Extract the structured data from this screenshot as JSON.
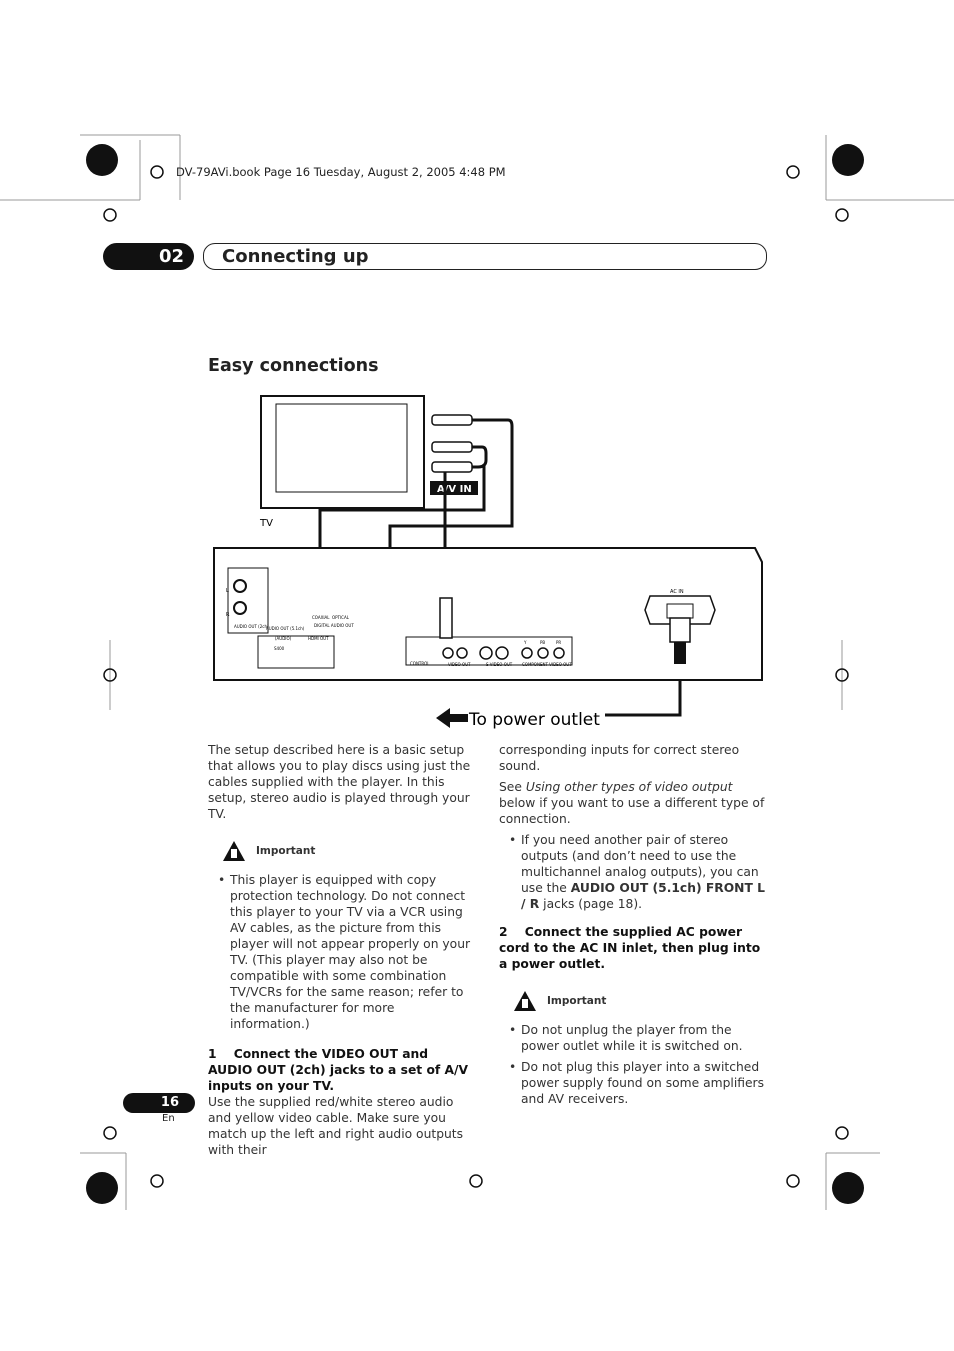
{
  "header": {
    "file_line": "DV-79AVi.book  Page 16  Tuesday, August 2, 2005  4:48 PM",
    "chapter_number": "02",
    "chapter_title": "Connecting up"
  },
  "section_title": "Easy connections",
  "diagram": {
    "tv_label": "TV",
    "av_in": "A/V IN",
    "power_outlet": "To power outlet",
    "ac_in": "AC  IN",
    "labels": {
      "l": "L",
      "r": "R",
      "audio_out_2ch": "AUDIO OUT (2ch)",
      "audio_out_51": "AUDIO OUT (5.1ch)",
      "coaxial": "COAXIAL",
      "optical": "OPTICAL",
      "digital_audio_out": "DIGITAL AUDIO OUT",
      "i_link": "(AUDIO)",
      "s400": "S400",
      "hdmi_out": "HDMI OUT",
      "control": "CONTROL",
      "video_out": "VIDEO OUT",
      "s_video_out": "S-VIDEO OUT",
      "component": "COMPONENT VIDEO OUT",
      "y": "Y",
      "pb": "PB",
      "pr": "PR"
    }
  },
  "left_column": {
    "intro": "The setup described here is a basic setup that allows you to play discs using just the cables supplied with the player. In this setup, stereo audio is played through your TV.",
    "important_label": "Important",
    "important_items": [
      "This player is equipped with copy protection technology. Do not connect this player to your TV via a VCR using AV cables, as the picture from this player will not appear properly on your TV. (This player may also not be compatible with some combination TV/VCRs for the same reason; refer to the manufacturer for more information.)"
    ],
    "step1_num": "1",
    "step1_title": "Connect the VIDEO OUT and AUDIO OUT (2ch) jacks to a set of A/V inputs on your TV.",
    "step1_body": "Use the supplied red/white stereo audio and yellow video cable. Make sure you match up the left and right audio outputs with their"
  },
  "right_column": {
    "cont": "corresponding inputs for correct stereo sound.",
    "see_pre": "See ",
    "see_italic": "Using other types of video output",
    "see_post": " below if you want to use a different type of connection.",
    "bullet_pre": "If you need another pair of stereo outputs (and don’t need to use the multichannel analog outputs), you can use the ",
    "bullet_bold": "AUDIO OUT (5.1ch) FRONT L / R",
    "bullet_post": " jacks (page 18).",
    "step2_num": "2",
    "step2_title": "Connect the supplied AC power cord to the AC IN inlet, then plug into a power outlet.",
    "important_label": "Important",
    "important_items": [
      "Do not unplug the player from the power outlet while it is switched on.",
      "Do not plug this player into a switched power supply found on some amplifiers and AV receivers."
    ]
  },
  "footer": {
    "page_number": "16",
    "lang": "En"
  }
}
